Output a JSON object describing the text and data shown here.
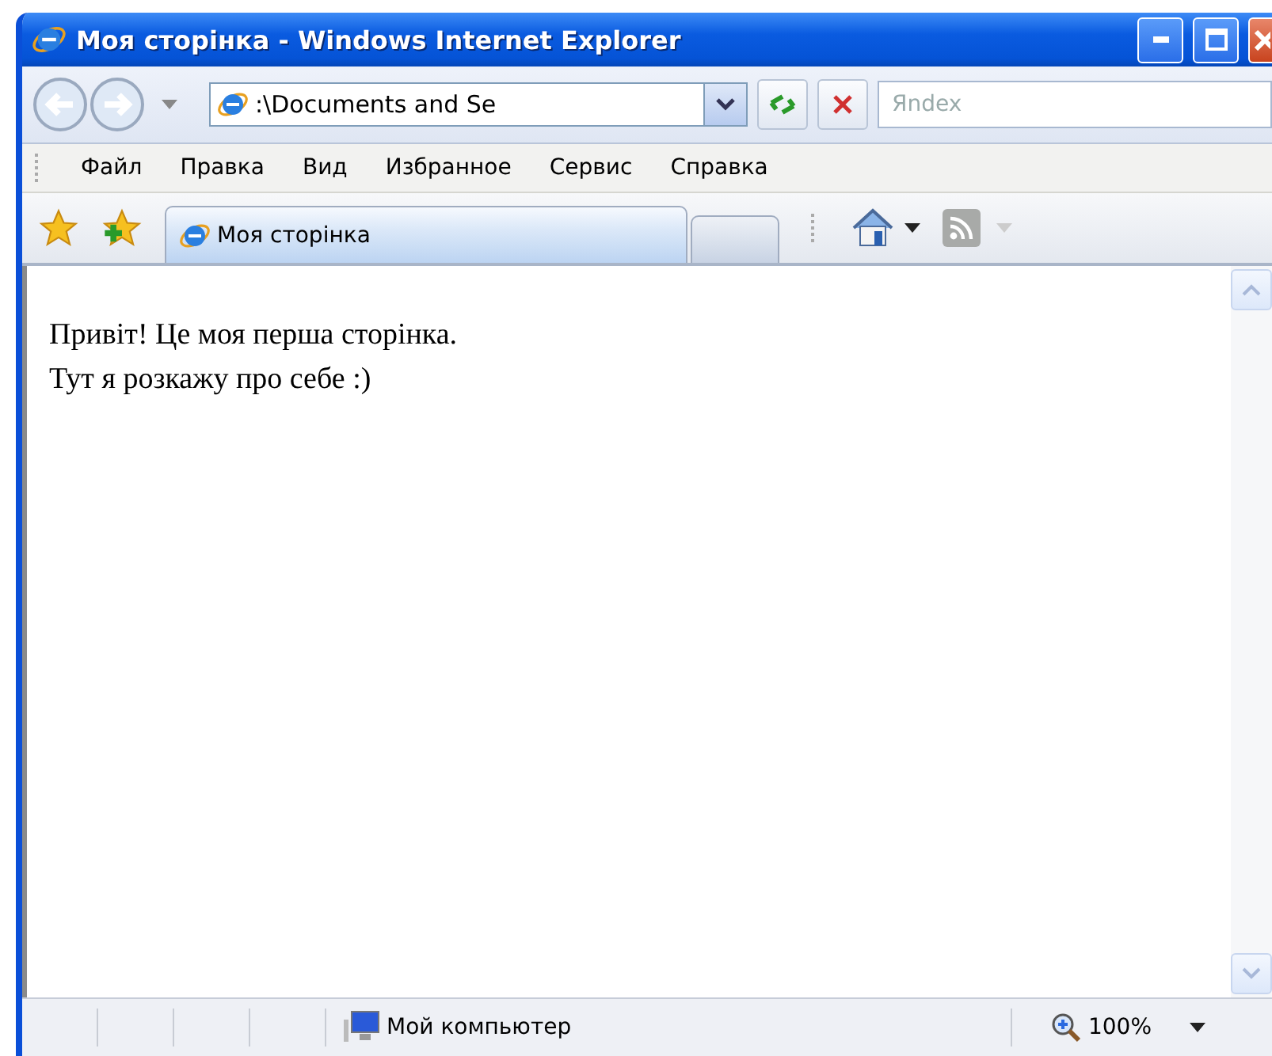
{
  "window": {
    "title": "Моя сторінка - Windows Internet Explorer"
  },
  "address_bar": {
    "value": ":\\Documents and Se"
  },
  "search": {
    "placeholder": "Яndex"
  },
  "menu": [
    {
      "label": "Файл"
    },
    {
      "label": "Правка"
    },
    {
      "label": "Вид"
    },
    {
      "label": "Избранное"
    },
    {
      "label": "Сервис"
    },
    {
      "label": "Справка"
    }
  ],
  "tabs": [
    {
      "label": "Моя сторінка",
      "selected": true
    }
  ],
  "page": {
    "lines": [
      "Привіт! Це моя перша сторінка.",
      "Тут я розкажу про себе :)"
    ]
  },
  "status_bar": {
    "zone": "Мой компьютер",
    "zoom": "100%"
  }
}
